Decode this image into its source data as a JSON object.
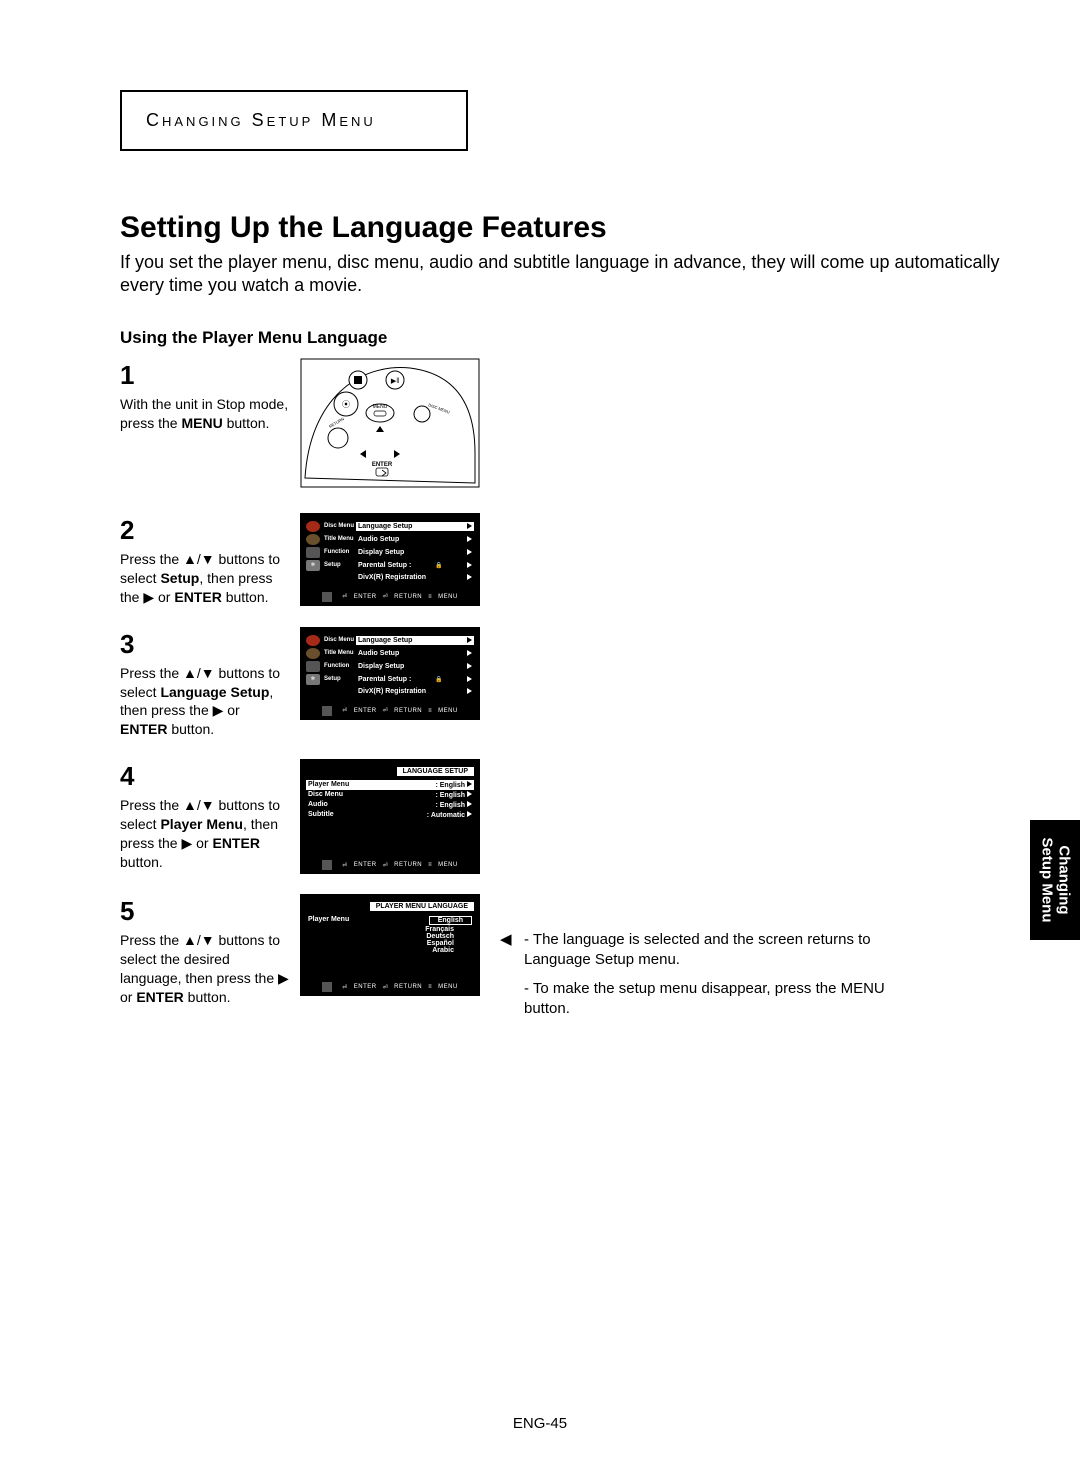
{
  "chapter": "Changing Setup Menu",
  "title": "Setting Up the Language Features",
  "intro": "If you set the player menu, disc menu, audio and subtitle language in advance, they will come up automatically every time you watch a movie.",
  "subhead": "Using the Player Menu Language",
  "steps": {
    "s1": {
      "num": "1",
      "text_a": "With the unit in Stop mode, press the ",
      "bold_a": "MENU",
      "text_b": " button."
    },
    "s2": {
      "num": "2",
      "text_a": "Press the ▲/▼ buttons to select ",
      "bold_a": "Setup",
      "text_b": ", then press the ▶ or ",
      "bold_b": "ENTER",
      "text_c": " button."
    },
    "s3": {
      "num": "3",
      "text_a": "Press the ▲/▼ buttons to select ",
      "bold_a": "Language Setup",
      "text_b": ", then press the ▶ or ",
      "bold_b": "ENTER",
      "text_c": " button."
    },
    "s4": {
      "num": "4",
      "text_a": "Press the ▲/▼ buttons to select ",
      "bold_a": "Player Menu",
      "text_b": ", then press the ▶ or ",
      "bold_b": "ENTER",
      "text_c": " button."
    },
    "s5": {
      "num": "5",
      "text_a": "Press the ▲/▼ buttons to select the desired language, then press the ▶ or ",
      "bold_a": "ENTER",
      "text_b": " button."
    }
  },
  "osd_side": {
    "disc": "Disc Menu",
    "title": "Title Menu",
    "func": "Function",
    "setup": "Setup"
  },
  "osd_setup_items": {
    "i1": "Language Setup",
    "i2": "Audio Setup",
    "i3": "Display Setup",
    "i4": "Parental Setup :",
    "i5": "DivX(R) Registration"
  },
  "osd_lang_setup": {
    "header": "LANGUAGE SETUP",
    "r1l": "Player Menu",
    "r1v": ": English",
    "r2l": "Disc Menu",
    "r2v": ": English",
    "r3l": "Audio",
    "r3v": ": English",
    "r4l": "Subtitle",
    "r4v": ": Automatic"
  },
  "osd_player_menu_lang": {
    "header": "PLAYER MENU LANGUAGE",
    "row_label": "Player Menu",
    "o1": "English",
    "o2": "Français",
    "o3": "Deutsch",
    "o4": "Español",
    "o5": "Arabic"
  },
  "osd_footer": {
    "enter": "ENTER",
    "ret": "RETURN",
    "menu": "MENU"
  },
  "notes": {
    "n1": "The language is selected and the screen returns to Language Setup menu.",
    "n2": "To make the setup menu disappear, press the MENU button."
  },
  "side_tab_l1": "Changing",
  "side_tab_l2": "Setup Menu",
  "page_num": "ENG-45"
}
